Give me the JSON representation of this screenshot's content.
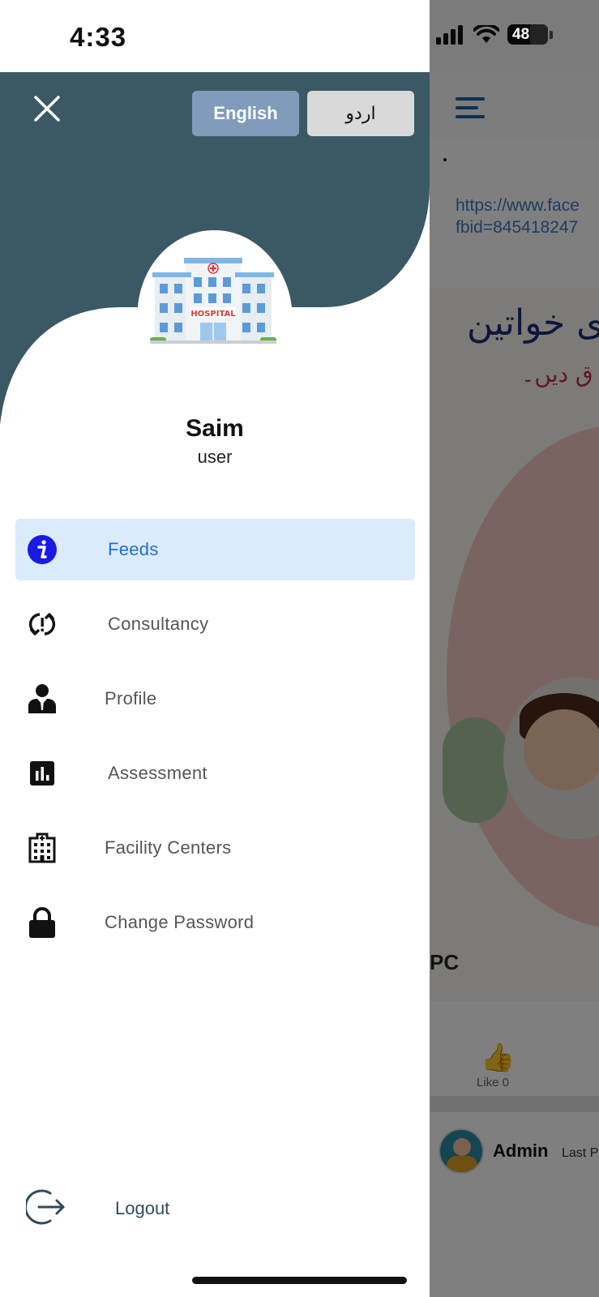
{
  "status_bar": {
    "time": "4:33",
    "battery": "48"
  },
  "drawer": {
    "languages": {
      "english": "English",
      "urdu": "اردو",
      "selected": "English"
    },
    "user": {
      "name": "Saim",
      "role": "user"
    },
    "menu": [
      {
        "label": "Feeds",
        "icon": "info-icon",
        "active": true
      },
      {
        "label": "Consultancy",
        "icon": "sync-alert-icon",
        "active": false
      },
      {
        "label": "Profile",
        "icon": "person-suit-icon",
        "active": false
      },
      {
        "label": "Assessment",
        "icon": "bar-chart-icon",
        "active": false
      },
      {
        "label": "Facility Centers",
        "icon": "building-icon",
        "active": false
      },
      {
        "label": "Change Password",
        "icon": "lock-icon",
        "active": false
      }
    ],
    "logout": {
      "label": "Logout",
      "icon": "logout-icon"
    }
  },
  "background": {
    "link_line1": "https://www.face",
    "link_line2": "fbid=845418247",
    "poster_urdu_line1": "ی خواتین",
    "poster_urdu_line2": "ق دیں۔",
    "poster_logo": "PC",
    "like_label": "Like 0",
    "post_author": "Admin",
    "post_meta": "Last P"
  },
  "colors": {
    "header_bg": "#3b5965",
    "active_item_bg": "#dcebfc",
    "active_item_text": "#1e6fd2",
    "english_btn": "#7f9cbb",
    "urdu_btn": "#d9d9d9"
  }
}
